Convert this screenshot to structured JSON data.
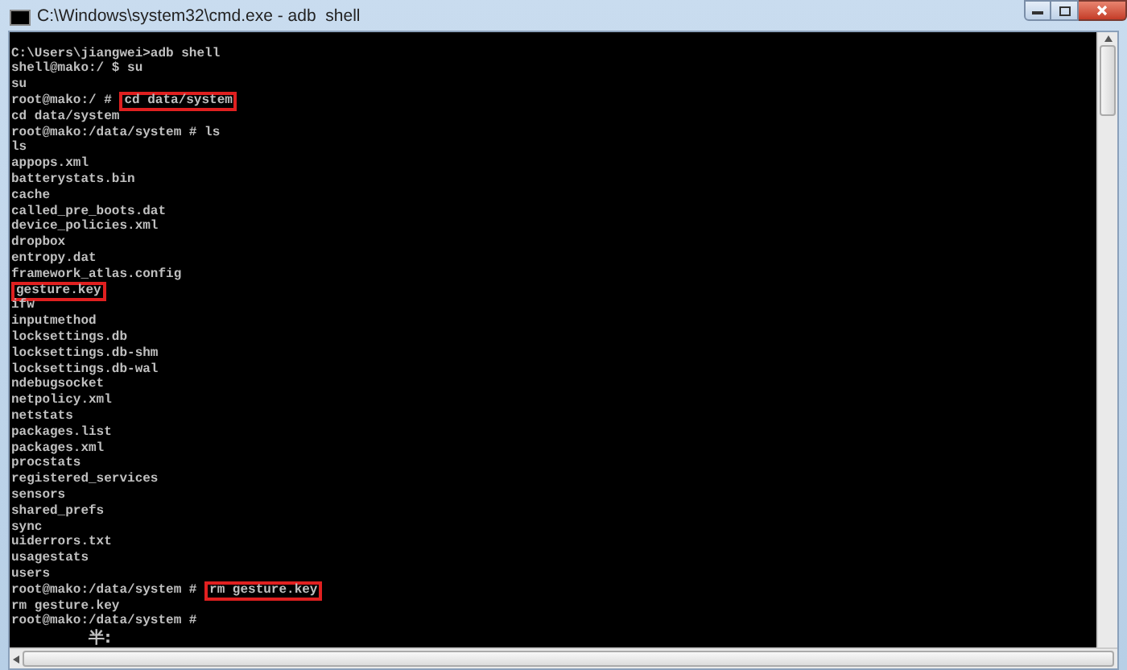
{
  "window": {
    "title": "C:\\Windows\\system32\\cmd.exe - adb  shell"
  },
  "console": {
    "lines": [
      {
        "text": "C:\\Users\\jiangwei>adb shell",
        "highlighted": false
      },
      {
        "text": "shell@mako:/ $ su",
        "highlighted": false
      },
      {
        "text": "su",
        "highlighted": false
      },
      {
        "prompt": "root@mako:/ #",
        "text": "cd data/system",
        "highlighted": true
      },
      {
        "text": "cd data/system",
        "highlighted": false
      },
      {
        "text": "root@mako:/data/system # ls",
        "highlighted": false
      },
      {
        "text": "ls",
        "highlighted": false
      },
      {
        "text": "appops.xml",
        "highlighted": false
      },
      {
        "text": "batterystats.bin",
        "highlighted": false
      },
      {
        "text": "cache",
        "highlighted": false
      },
      {
        "text": "called_pre_boots.dat",
        "highlighted": false
      },
      {
        "text": "device_policies.xml",
        "highlighted": false
      },
      {
        "text": "dropbox",
        "highlighted": false
      },
      {
        "text": "entropy.dat",
        "highlighted": false
      },
      {
        "text": "framework_atlas.config",
        "highlighted": false
      },
      {
        "text": "gesture.key",
        "highlighted": true
      },
      {
        "text": "ifw",
        "highlighted": false
      },
      {
        "text": "inputmethod",
        "highlighted": false
      },
      {
        "text": "locksettings.db",
        "highlighted": false
      },
      {
        "text": "locksettings.db-shm",
        "highlighted": false
      },
      {
        "text": "locksettings.db-wal",
        "highlighted": false
      },
      {
        "text": "ndebugsocket",
        "highlighted": false
      },
      {
        "text": "netpolicy.xml",
        "highlighted": false
      },
      {
        "text": "netstats",
        "highlighted": false
      },
      {
        "text": "packages.list",
        "highlighted": false
      },
      {
        "text": "packages.xml",
        "highlighted": false
      },
      {
        "text": "procstats",
        "highlighted": false
      },
      {
        "text": "registered_services",
        "highlighted": false
      },
      {
        "text": "sensors",
        "highlighted": false
      },
      {
        "text": "shared_prefs",
        "highlighted": false
      },
      {
        "text": "sync",
        "highlighted": false
      },
      {
        "text": "uiderrors.txt",
        "highlighted": false
      },
      {
        "text": "usagestats",
        "highlighted": false
      },
      {
        "text": "users",
        "highlighted": false
      },
      {
        "prompt": "root@mako:/data/system #",
        "text": "rm gesture.key",
        "highlighted": true
      },
      {
        "text": "rm gesture.key",
        "highlighted": false
      },
      {
        "text": "root@mako:/data/system #",
        "highlighted": false
      }
    ],
    "ime_status": "半:"
  }
}
